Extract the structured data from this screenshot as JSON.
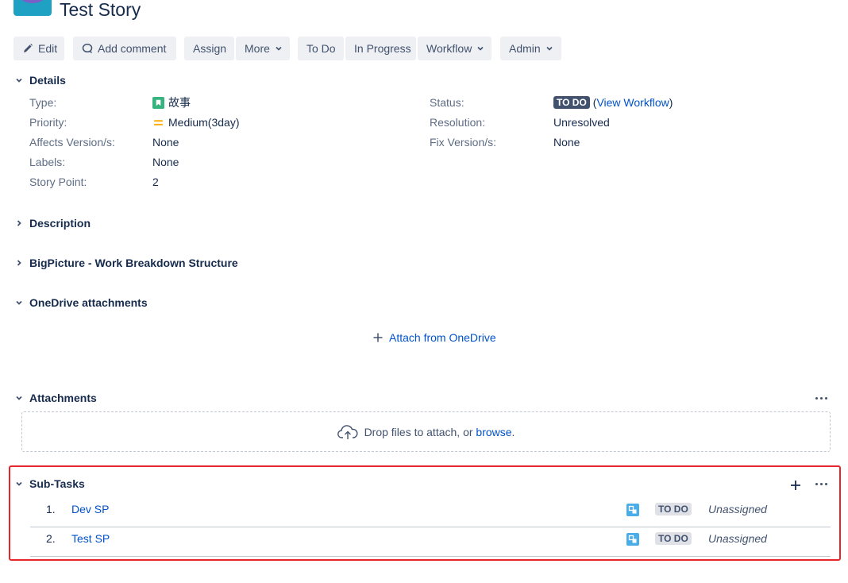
{
  "issue": {
    "title": "Test Story"
  },
  "toolbar": {
    "edit": "Edit",
    "add_comment": "Add comment",
    "assign": "Assign",
    "more": "More",
    "todo": "To Do",
    "in_progress": "In Progress",
    "workflow": "Workflow",
    "admin": "Admin"
  },
  "details": {
    "title": "Details",
    "type_label": "Type:",
    "type_value": "故事",
    "priority_label": "Priority:",
    "priority_value": "Medium(3day)",
    "affects_label": "Affects Version/s:",
    "affects_value": "None",
    "labels_label": "Labels:",
    "labels_value": "None",
    "story_point_label": "Story Point:",
    "story_point_value": "2",
    "status_label": "Status:",
    "status_value": "TO DO",
    "view_workflow_open": "(",
    "view_workflow": "View Workflow",
    "view_workflow_close": ")",
    "resolution_label": "Resolution:",
    "resolution_value": "Unresolved",
    "fix_label": "Fix Version/s:",
    "fix_value": "None"
  },
  "sections": {
    "description": "Description",
    "bigpicture": "BigPicture - Work Breakdown Structure",
    "onedrive": "OneDrive attachments",
    "attach_onedrive": "Attach from OneDrive",
    "attachments": "Attachments",
    "drop_text": "Drop files to attach, or",
    "browse": "browse",
    "drop_period": ".",
    "subtasks": "Sub-Tasks"
  },
  "subtasks": [
    {
      "num": "1.",
      "name": "Dev SP",
      "status": "TO DO",
      "assignee": "Unassigned"
    },
    {
      "num": "2.",
      "name": "Test SP",
      "status": "TO DO",
      "assignee": "Unassigned"
    }
  ],
  "colors": {
    "link": "#0052cc",
    "story_icon": "#36b37e",
    "priority_medium": "#ffab00",
    "subtask_icon": "#4bade8",
    "highlight": "#e8262a"
  }
}
